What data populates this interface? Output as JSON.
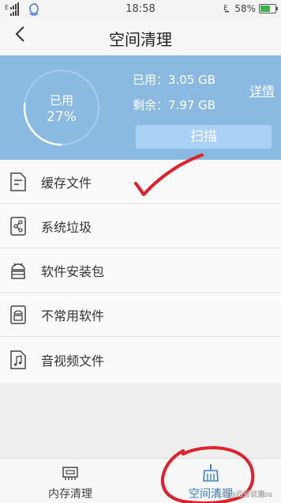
{
  "status_bar": {
    "time": "18:58",
    "battery": "58%",
    "battery_level": 0.58
  },
  "header": {
    "title": "空间清理"
  },
  "storage": {
    "gauge_label": "已用",
    "gauge_value": "27%",
    "used_fraction": 0.27,
    "used_line": "已用：3.05 GB",
    "free_line": "剩余：7.97 GB",
    "detail_link": "详情",
    "scan_button": "扫描"
  },
  "list": {
    "items": [
      {
        "label": "缓存文件",
        "icon": "document-icon"
      },
      {
        "label": "系统垃圾",
        "icon": "share-file-icon"
      },
      {
        "label": "软件安装包",
        "icon": "android-icon"
      },
      {
        "label": "不常用软件",
        "icon": "android-box-icon"
      },
      {
        "label": "音视频文件",
        "icon": "music-file-icon"
      }
    ]
  },
  "bottom_nav": {
    "tabs": [
      {
        "label": "内存清理",
        "icon": "memory-chip-icon"
      },
      {
        "label": "空间清理",
        "icon": "broom-icon"
      }
    ]
  },
  "colors": {
    "panel": "#8ab9e2",
    "scan_button": "#a9d2f6",
    "active_tab": "#3a82c4",
    "annotation": "#e2202a"
  },
  "watermark": "头条@西哥说测sa"
}
